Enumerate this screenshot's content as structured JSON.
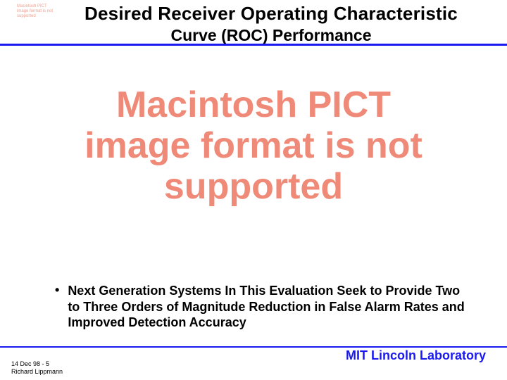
{
  "placeholder_small": "Macintosh PICT image format is not supported",
  "title": {
    "line1": "Desired Receiver Operating Characteristic",
    "line2": "Curve (ROC) Performance"
  },
  "placeholder_large": "Macintosh PICT image format is not supported",
  "bullet": {
    "text": "Next Generation Systems In This Evaluation Seek to Provide Two to Three Orders of Magnitude Reduction in False Alarm Rates and Improved Detection Accuracy"
  },
  "footer": {
    "left_line1": "14   Dec 98 - 5",
    "left_line2": "Richard Lippmann",
    "right": "MIT Lincoln Laboratory"
  },
  "colors": {
    "accent_blue": "#1a1af0",
    "placeholder_pink": "#f08a78"
  }
}
